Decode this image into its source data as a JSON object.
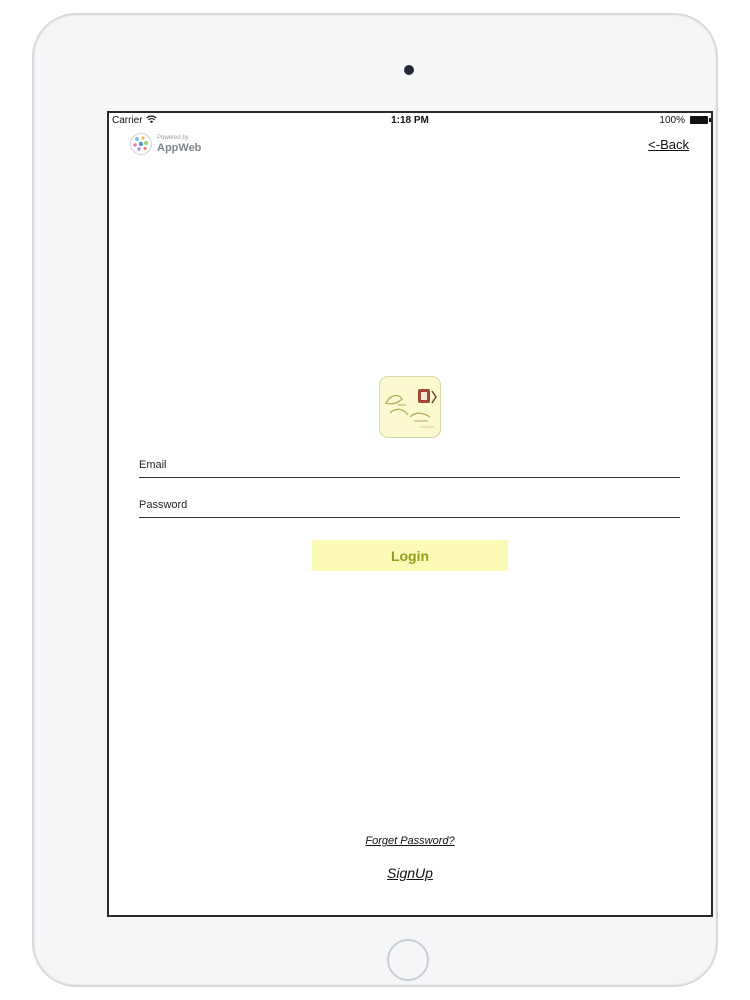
{
  "status_bar": {
    "carrier": "Carrier",
    "time": "1:18 PM",
    "battery": "100%"
  },
  "header": {
    "powered_by": "Powered by",
    "brand_name": "AppWeb",
    "back_label": "<-Back"
  },
  "login_form": {
    "email_placeholder": "Email",
    "password_placeholder": "Password",
    "login_label": "Login"
  },
  "footer": {
    "forget_password_label": "Forget Password?",
    "signup_label": "SignUp"
  },
  "colors": {
    "login_bg": "#fbfbb7",
    "login_text": "#8ea11a",
    "logo_bg": "#fbf9cf"
  }
}
